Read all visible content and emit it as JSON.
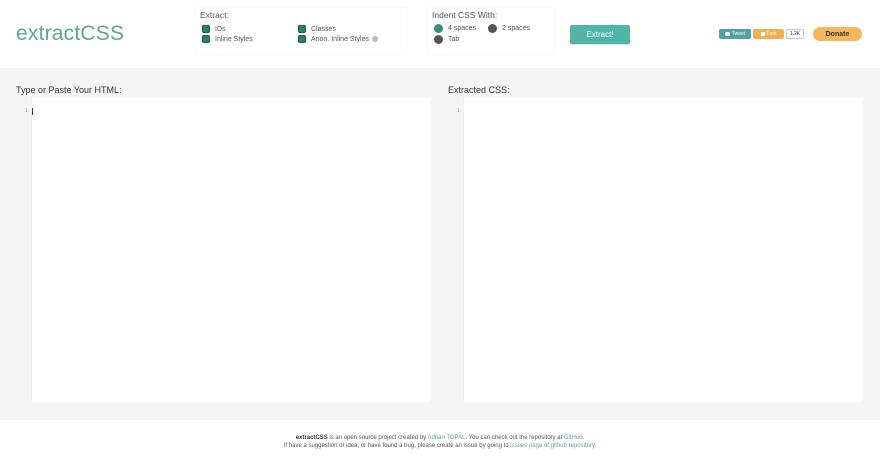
{
  "header": {
    "logo": "extractCSS",
    "extract_panel": {
      "title": "Extract:",
      "options": [
        {
          "label": "IDs",
          "checked": true
        },
        {
          "label": "Classes",
          "checked": true
        },
        {
          "label": "Inline Styles",
          "checked": true
        },
        {
          "label": "Anon. Inline Styles",
          "checked": true
        }
      ]
    },
    "indent_panel": {
      "title": "Indent CSS With:",
      "options": [
        {
          "label": "4 spaces",
          "selected": true
        },
        {
          "label": "2 spaces",
          "selected": false
        },
        {
          "label": "Tab",
          "selected": false
        }
      ]
    },
    "extract_button": "Extract!",
    "social": {
      "tweet_label": "Tweet",
      "fork_label": "Fork",
      "count": "1.2K"
    },
    "donate_button": "Donate"
  },
  "editors": {
    "input": {
      "label": "Type or Paste Your HTML:",
      "line_number": "1"
    },
    "output": {
      "label": "Extracted CSS:",
      "line_number": "1"
    }
  },
  "footer": {
    "line1": {
      "brand": "extractCSS",
      "text_a": " is an open source project created by ",
      "author_link": "Adnan TOPAL",
      "text_b": ". You can check out the repository at ",
      "github_link": "GitHub",
      "text_c": "."
    },
    "line2": {
      "text_a": "If have a suggestion or idea, or have found a bug, please create an issue by going to ",
      "issues_link": "issues page of github repository",
      "text_b": "."
    }
  },
  "colors": {
    "accent": "#4fb5a8",
    "logo": "#58a6a0",
    "donate": "#f7b65a",
    "background": "#f5f5f5"
  }
}
